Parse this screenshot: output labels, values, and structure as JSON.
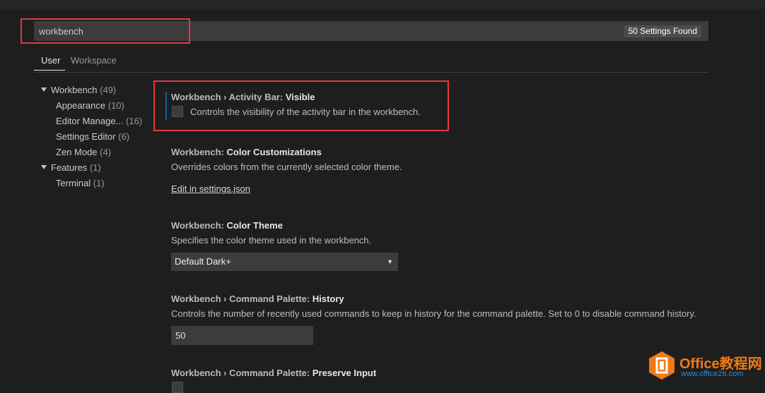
{
  "search": {
    "value": "workbench",
    "results_count": "50 Settings Found"
  },
  "tabs": [
    {
      "label": "User"
    },
    {
      "label": "Workspace"
    }
  ],
  "toc": [
    {
      "label": "Workbench",
      "count": "(49)"
    },
    {
      "label": "Appearance",
      "count": "(10)"
    },
    {
      "label": "Editor Manage...",
      "count": "(16)"
    },
    {
      "label": "Settings Editor",
      "count": "(6)"
    },
    {
      "label": "Zen Mode",
      "count": "(4)"
    },
    {
      "label": "Features",
      "count": "(1)"
    },
    {
      "label": "Terminal",
      "count": "(1)"
    }
  ],
  "settings": [
    {
      "category": "Workbench › Activity Bar: ",
      "name": "Visible",
      "description": "Controls the visibility of the activity bar in the workbench.",
      "checked": false
    },
    {
      "category": "Workbench: ",
      "name": "Color Customizations",
      "description": "Overrides colors from the currently selected color theme.",
      "link": "Edit in settings.json"
    },
    {
      "category": "Workbench: ",
      "name": "Color Theme",
      "description": "Specifies the color theme used in the workbench.",
      "value": "Default Dark+"
    },
    {
      "category": "Workbench › Command Palette: ",
      "name": "History",
      "description": "Controls the number of recently used commands to keep in history for the command palette. Set to 0 to disable command history.",
      "value": "50"
    },
    {
      "category": "Workbench › Command Palette: ",
      "name": "Preserve Input"
    }
  ],
  "watermark": {
    "title": "Office教程网",
    "url": "www.office26.com"
  },
  "colors": {
    "highlight": "#e5393b",
    "background": "#1e1e1e",
    "input": "#3c3c3c",
    "focus": "#0e639c"
  }
}
